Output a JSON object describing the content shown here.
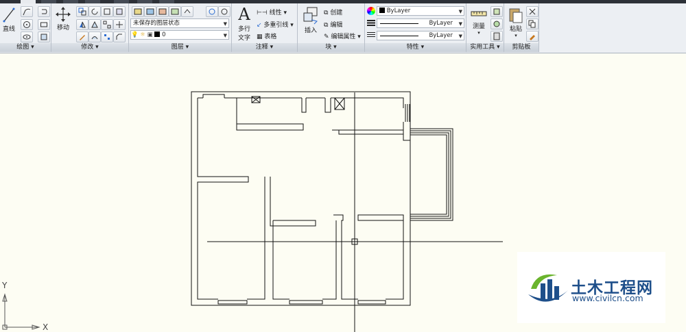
{
  "ribbon": {
    "panels": {
      "draw": "绘图 ▾",
      "modify": "修改 ▾",
      "layers": "图层 ▾",
      "annotation": "注释 ▾",
      "block": "块 ▾",
      "properties": "特性 ▾",
      "utilities": "实用工具 ▾",
      "clipboard": "剪贴板"
    },
    "draw": {
      "line_label": "直线"
    },
    "modify": {
      "move_label": "移动"
    },
    "layers": {
      "layer_state": "未保存的图层状态",
      "current_layer": "0"
    },
    "annotation": {
      "text_label_1": "多行",
      "text_label_2": "文字",
      "linear_label": "线性",
      "multileader_label": "多重引线",
      "table_label": "表格"
    },
    "block": {
      "insert_label": "插入",
      "create_label": "创建",
      "edit_label": "编辑",
      "edit_attributes_label": "编辑属性"
    },
    "properties": {
      "color": "ByLayer",
      "linetype": "ByLayer",
      "lineweight": "ByLayer"
    },
    "utilities": {
      "measure_label": "测量"
    },
    "clipboard": {
      "paste_label": "粘贴"
    }
  },
  "ucs": {
    "x_label": "X",
    "y_label": "Y"
  },
  "watermark": {
    "title": "土木工程网",
    "url": "www.civilcn.com"
  },
  "colors": {
    "canvas_bg": "#fdfdf3",
    "ribbon_bg": "#eceff3",
    "logo_blue": "#1e4f8a",
    "logo_green": "#6ab42d"
  }
}
